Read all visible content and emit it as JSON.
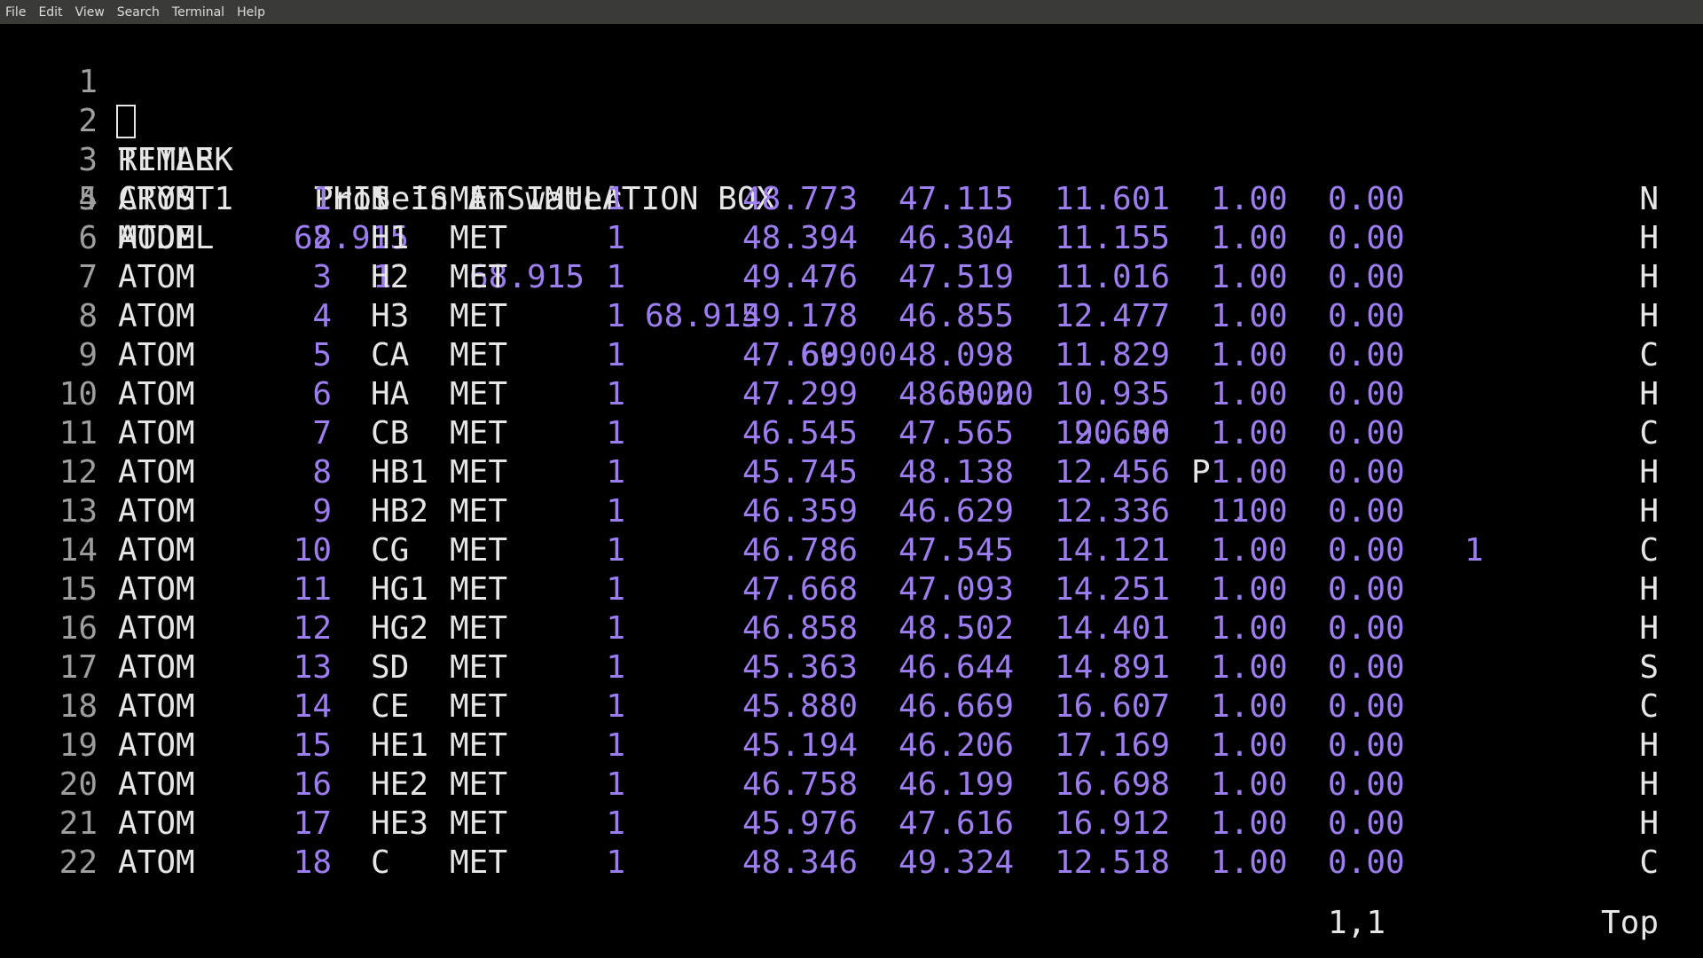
{
  "menubar": {
    "items": [
      "File",
      "Edit",
      "View",
      "Search",
      "Terminal",
      "Help"
    ]
  },
  "editor": {
    "header_lines": [
      {
        "num": "1",
        "record": "TITLE",
        "text": "Protein in water"
      },
      {
        "num": "2",
        "record": "REMARK",
        "text": "THIS IS A SIMULATION BOX"
      },
      {
        "num": "3",
        "record": "CRYST1",
        "a": "68.915",
        "b": "68.915",
        "c": "68.915",
        "alpha": "60.00",
        "beta": "60.00",
        "gamma": "90.00",
        "space_group_letter": "P",
        "space_group_num": "1",
        "z": "1"
      },
      {
        "num": "4",
        "record": "MODEL",
        "model": "1"
      }
    ],
    "atoms": [
      {
        "num": "5",
        "record": "ATOM",
        "serial": "1",
        "name": "N",
        "res": "MET",
        "resseq": "1",
        "x": "48.773",
        "y": "47.115",
        "z": "11.601",
        "occ": "1.00",
        "bfac": "0.00",
        "elem": "N"
      },
      {
        "num": "6",
        "record": "ATOM",
        "serial": "2",
        "name": "H1",
        "res": "MET",
        "resseq": "1",
        "x": "48.394",
        "y": "46.304",
        "z": "11.155",
        "occ": "1.00",
        "bfac": "0.00",
        "elem": "H"
      },
      {
        "num": "7",
        "record": "ATOM",
        "serial": "3",
        "name": "H2",
        "res": "MET",
        "resseq": "1",
        "x": "49.476",
        "y": "47.519",
        "z": "11.016",
        "occ": "1.00",
        "bfac": "0.00",
        "elem": "H"
      },
      {
        "num": "8",
        "record": "ATOM",
        "serial": "4",
        "name": "H3",
        "res": "MET",
        "resseq": "1",
        "x": "49.178",
        "y": "46.855",
        "z": "12.477",
        "occ": "1.00",
        "bfac": "0.00",
        "elem": "H"
      },
      {
        "num": "9",
        "record": "ATOM",
        "serial": "5",
        "name": "CA",
        "res": "MET",
        "resseq": "1",
        "x": "47.699",
        "y": "48.098",
        "z": "11.829",
        "occ": "1.00",
        "bfac": "0.00",
        "elem": "C"
      },
      {
        "num": "10",
        "record": "ATOM",
        "serial": "6",
        "name": "HA",
        "res": "MET",
        "resseq": "1",
        "x": "47.299",
        "y": "48.302",
        "z": "10.935",
        "occ": "1.00",
        "bfac": "0.00",
        "elem": "H"
      },
      {
        "num": "11",
        "record": "ATOM",
        "serial": "7",
        "name": "CB",
        "res": "MET",
        "resseq": "1",
        "x": "46.545",
        "y": "47.565",
        "z": "12.636",
        "occ": "1.00",
        "bfac": "0.00",
        "elem": "C"
      },
      {
        "num": "12",
        "record": "ATOM",
        "serial": "8",
        "name": "HB1",
        "res": "MET",
        "resseq": "1",
        "x": "45.745",
        "y": "48.138",
        "z": "12.456",
        "occ": "1.00",
        "bfac": "0.00",
        "elem": "H"
      },
      {
        "num": "13",
        "record": "ATOM",
        "serial": "9",
        "name": "HB2",
        "res": "MET",
        "resseq": "1",
        "x": "46.359",
        "y": "46.629",
        "z": "12.336",
        "occ": "1.00",
        "bfac": "0.00",
        "elem": "H"
      },
      {
        "num": "14",
        "record": "ATOM",
        "serial": "10",
        "name": "CG",
        "res": "MET",
        "resseq": "1",
        "x": "46.786",
        "y": "47.545",
        "z": "14.121",
        "occ": "1.00",
        "bfac": "0.00",
        "elem": "C"
      },
      {
        "num": "15",
        "record": "ATOM",
        "serial": "11",
        "name": "HG1",
        "res": "MET",
        "resseq": "1",
        "x": "47.668",
        "y": "47.093",
        "z": "14.251",
        "occ": "1.00",
        "bfac": "0.00",
        "elem": "H"
      },
      {
        "num": "16",
        "record": "ATOM",
        "serial": "12",
        "name": "HG2",
        "res": "MET",
        "resseq": "1",
        "x": "46.858",
        "y": "48.502",
        "z": "14.401",
        "occ": "1.00",
        "bfac": "0.00",
        "elem": "H"
      },
      {
        "num": "17",
        "record": "ATOM",
        "serial": "13",
        "name": "SD",
        "res": "MET",
        "resseq": "1",
        "x": "45.363",
        "y": "46.644",
        "z": "14.891",
        "occ": "1.00",
        "bfac": "0.00",
        "elem": "S"
      },
      {
        "num": "18",
        "record": "ATOM",
        "serial": "14",
        "name": "CE",
        "res": "MET",
        "resseq": "1",
        "x": "45.880",
        "y": "46.669",
        "z": "16.607",
        "occ": "1.00",
        "bfac": "0.00",
        "elem": "C"
      },
      {
        "num": "19",
        "record": "ATOM",
        "serial": "15",
        "name": "HE1",
        "res": "MET",
        "resseq": "1",
        "x": "45.194",
        "y": "46.206",
        "z": "17.169",
        "occ": "1.00",
        "bfac": "0.00",
        "elem": "H"
      },
      {
        "num": "20",
        "record": "ATOM",
        "serial": "16",
        "name": "HE2",
        "res": "MET",
        "resseq": "1",
        "x": "46.758",
        "y": "46.199",
        "z": "16.698",
        "occ": "1.00",
        "bfac": "0.00",
        "elem": "H"
      },
      {
        "num": "21",
        "record": "ATOM",
        "serial": "17",
        "name": "HE3",
        "res": "MET",
        "resseq": "1",
        "x": "45.976",
        "y": "47.616",
        "z": "16.912",
        "occ": "1.00",
        "bfac": "0.00",
        "elem": "H"
      },
      {
        "num": "22",
        "record": "ATOM",
        "serial": "18",
        "name": "C",
        "res": "MET",
        "resseq": "1",
        "x": "48.346",
        "y": "49.324",
        "z": "12.518",
        "occ": "1.00",
        "bfac": "0.00",
        "elem": "C"
      }
    ]
  },
  "statusline": {
    "position": "1,1",
    "scroll": "Top"
  },
  "colors": {
    "background": "#000000",
    "text": "#e6e6e6",
    "numbers": "#9d7ef0",
    "line_numbers": "#9e9e9e",
    "menubar": "#3a3a37"
  }
}
